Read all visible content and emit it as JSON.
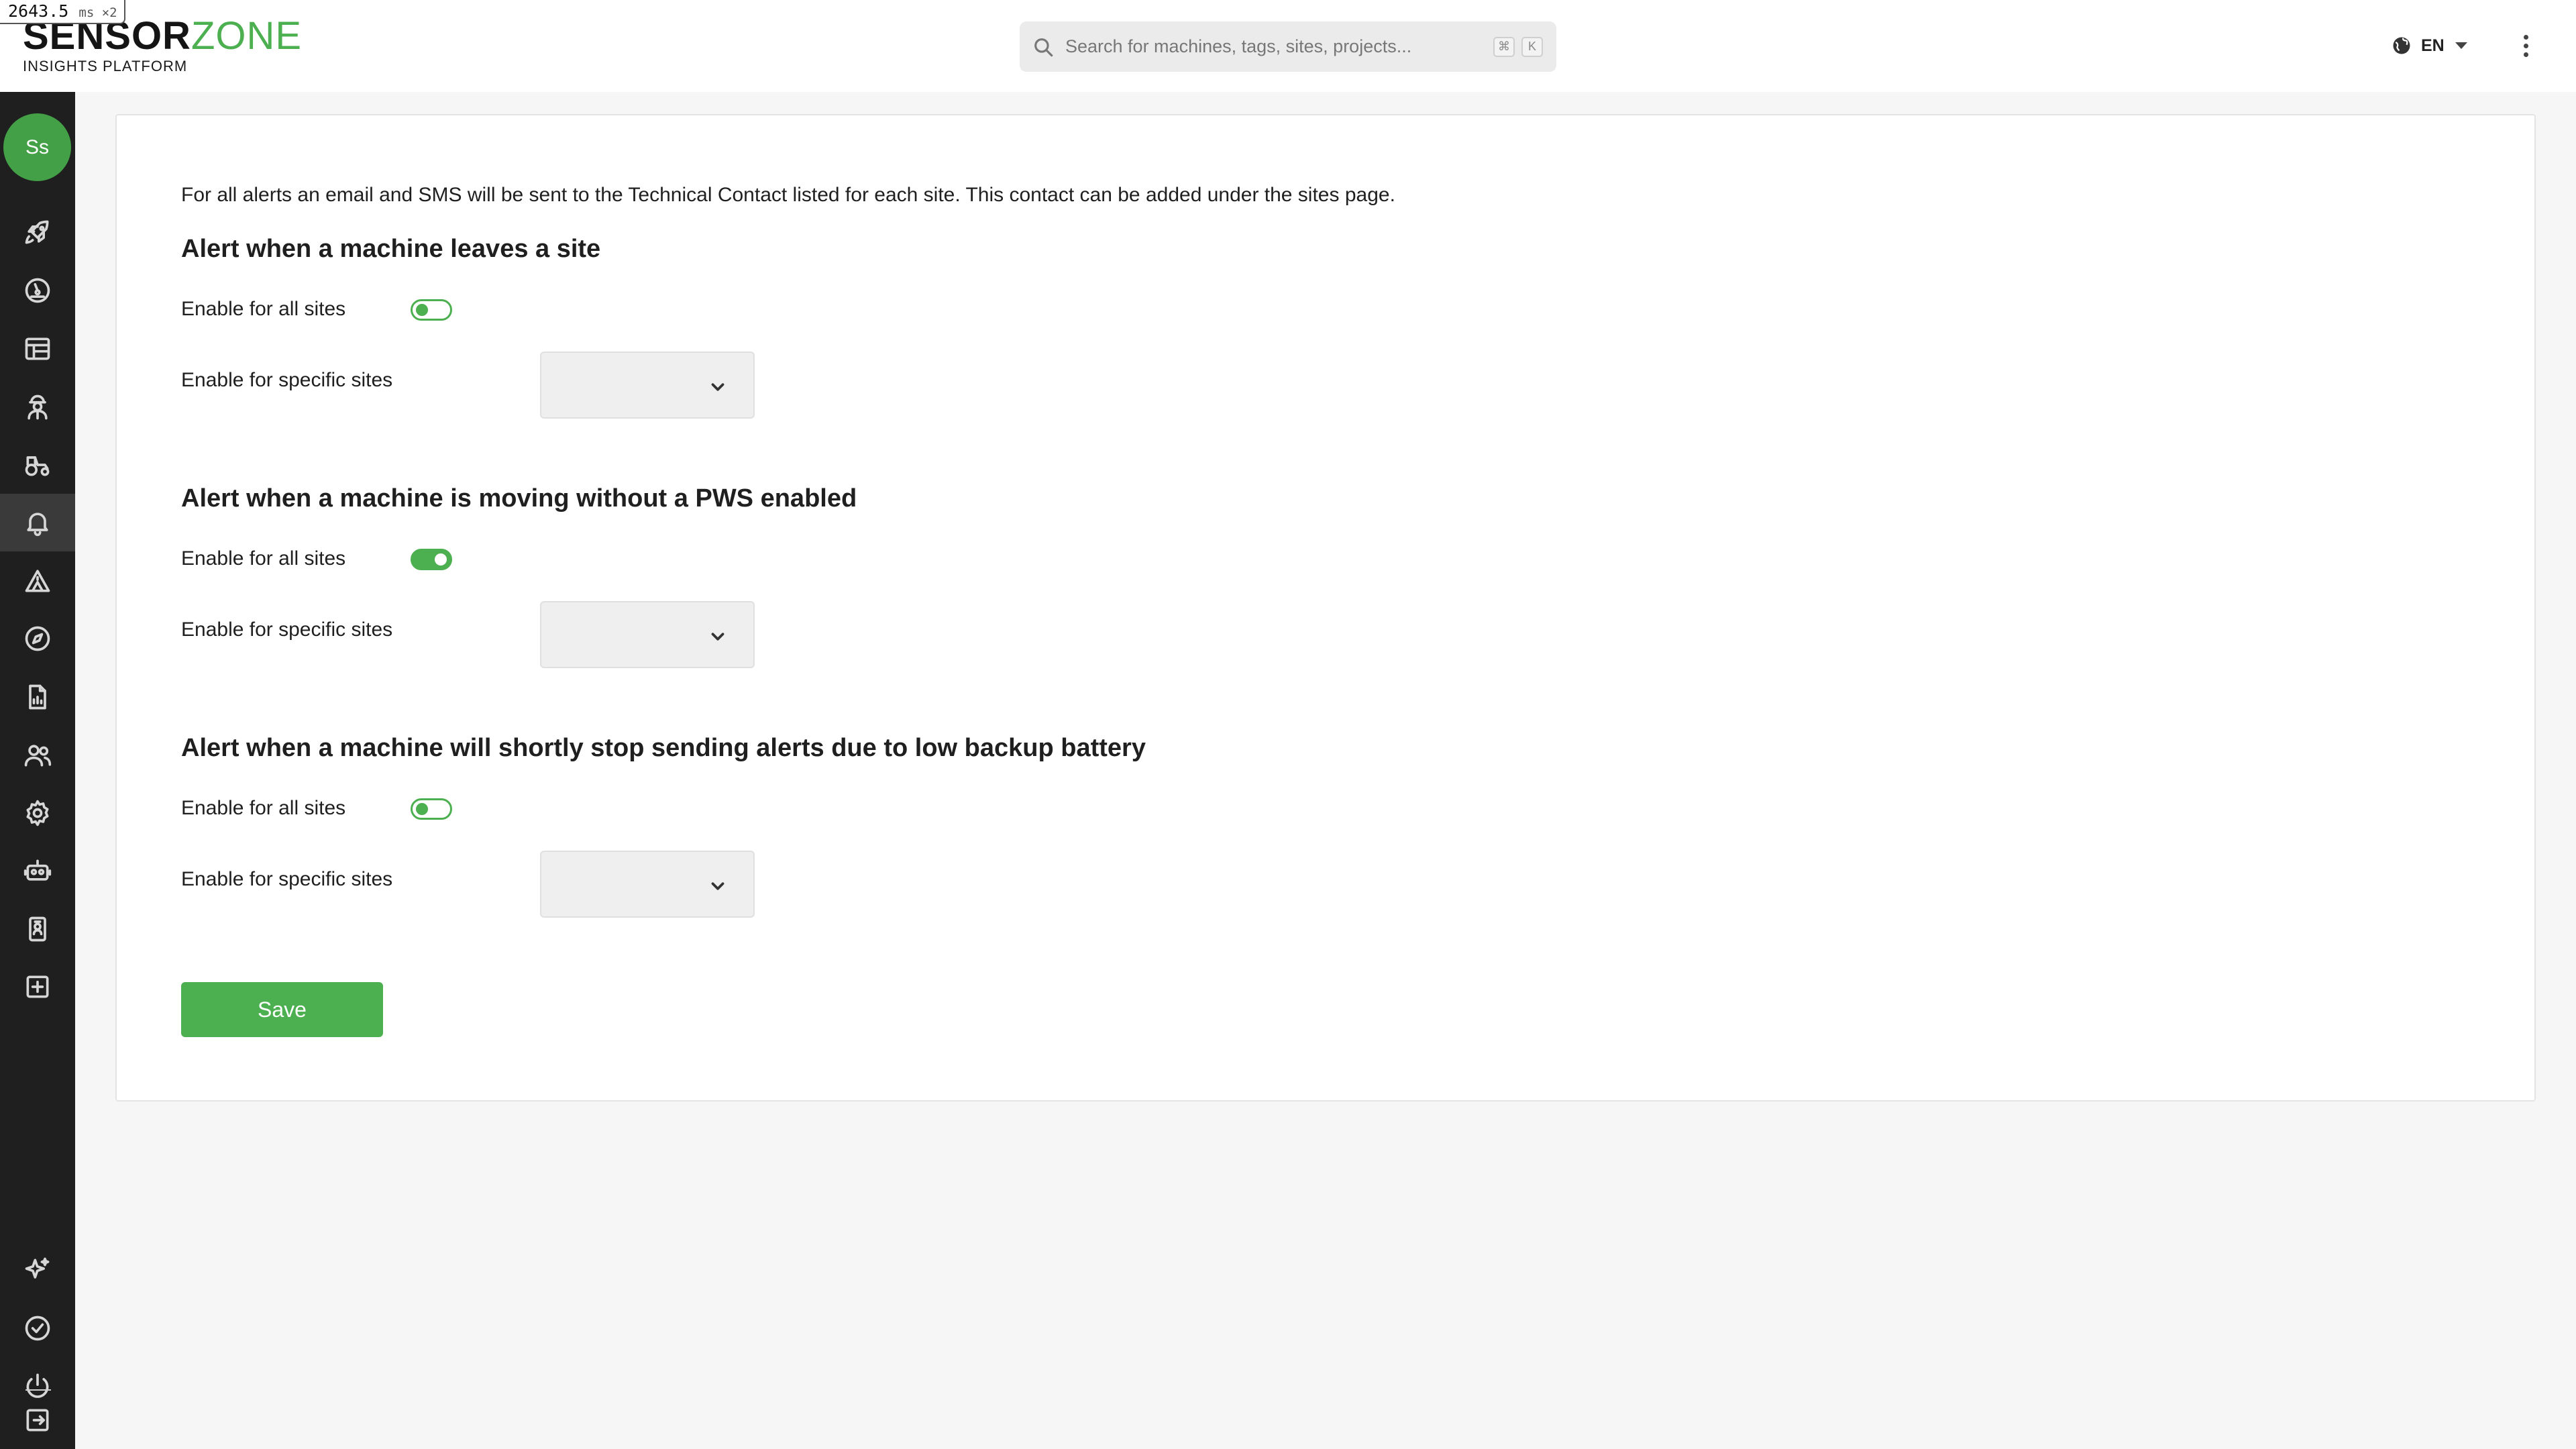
{
  "perf_badge": {
    "value": "2643.5",
    "unit": "ms ×2"
  },
  "header": {
    "logo_bold": "SENSOR",
    "logo_light": "ZONE",
    "logo_subtitle": "INSIGHTS PLATFORM",
    "search": {
      "placeholder": "Search for machines, tags, sites, projects...",
      "shortcut_keys": [
        "⌘",
        "K"
      ]
    },
    "language": "EN",
    "icons": {
      "search": "search-icon",
      "language": "globe-icon",
      "menu": "kebab-menu-icon"
    }
  },
  "sidebar": {
    "avatar_initials": "Ss",
    "items": [
      {
        "name": "rocket",
        "icon": "rocket-icon"
      },
      {
        "name": "dashboard",
        "icon": "gauge-icon"
      },
      {
        "name": "reports-table",
        "icon": "table-icon"
      },
      {
        "name": "operators",
        "icon": "worker-icon"
      },
      {
        "name": "machines",
        "icon": "tractor-icon"
      },
      {
        "name": "alerts",
        "icon": "bell-icon",
        "active": true
      },
      {
        "name": "sites",
        "icon": "site-icon"
      },
      {
        "name": "explore",
        "icon": "compass-icon"
      },
      {
        "name": "documents",
        "icon": "document-chart-icon"
      },
      {
        "name": "users",
        "icon": "users-icon"
      },
      {
        "name": "settings",
        "icon": "gear-icon"
      },
      {
        "name": "robot",
        "icon": "robot-icon"
      },
      {
        "name": "badge",
        "icon": "id-badge-icon"
      },
      {
        "name": "add",
        "icon": "plus-square-icon"
      },
      {
        "name": "ai",
        "icon": "sparkles-icon"
      },
      {
        "name": "check",
        "icon": "check-circle-icon"
      },
      {
        "name": "power",
        "icon": "power-icon"
      },
      {
        "name": "logout",
        "icon": "logout-icon"
      }
    ]
  },
  "content": {
    "intro": "For all alerts an email and SMS will be sent to the Technical Contact listed for each site. This contact can be added under the sites page.",
    "sections": [
      {
        "title_prefix": "Alert when a machine ",
        "title_bold": "leaves a site",
        "enable_all_label": "Enable for all sites",
        "enable_all": false,
        "specific_label": "Enable for specific sites",
        "specific_value": ""
      },
      {
        "title_prefix": "Alert when a machine is moving without a ",
        "title_bold": "PWS enabled",
        "enable_all_label": "Enable for all sites",
        "enable_all": true,
        "specific_label": "Enable for specific sites",
        "specific_value": ""
      },
      {
        "title_prefix": "Alert when a machine will shortly stop sending alerts due to ",
        "title_bold": "low backup battery",
        "enable_all_label": "Enable for all sites",
        "enable_all": false,
        "specific_label": "Enable for specific sites",
        "specific_value": ""
      }
    ],
    "save_label": "Save"
  },
  "colors": {
    "accent": "#4caf50",
    "sidebar_bg": "#1f1f1f",
    "page_bg": "#f6f6f6"
  }
}
